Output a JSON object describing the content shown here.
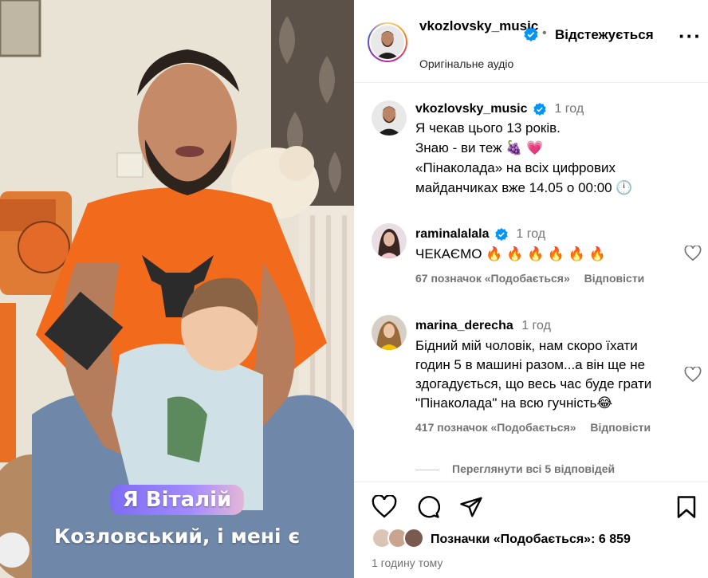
{
  "media": {
    "caption_line1": "Я Віталій",
    "caption_line2": "Козловський, і мені є",
    "shirt_color": "#f26a1b",
    "caption_gradient": [
      "#7d6cf2",
      "#e4b7d6"
    ]
  },
  "header": {
    "username": "vkozlovsky_music",
    "separator": "•",
    "follow_status": "Відстежується",
    "more_icon": "more-horizontal-icon",
    "audio": "Оригінальне аудіо"
  },
  "caption": {
    "username": "vkozlovsky_music",
    "time": "1 год",
    "lines": [
      "Я чекав цього 13 років.",
      "Знаю - ви теж 🍇 💗",
      "«Пінаколада» на всіх цифрових",
      "майданчиках вже 14.05 о 00:00 🕛"
    ]
  },
  "comments": [
    {
      "username": "raminalalala",
      "verified": true,
      "time": "1 год",
      "text": "ЧЕКАЄМО 🔥 🔥 🔥 🔥 🔥 🔥",
      "likes": "67 позначок «Подобається»",
      "reply": "Відповісти"
    },
    {
      "username": "marina_derecha",
      "verified": false,
      "time": "1 год",
      "text_lines": [
        "Бідний мій чоловік, нам скоро їхати",
        "годин 5 в машині разом...а він ще не",
        "здогадується, що весь час буде грати",
        "\"Пінаколада\" на всю гучність😂"
      ],
      "likes": "417 позначок «Подобається»",
      "reply": "Відповісти"
    }
  ],
  "view_replies": "Переглянути всі 5 відповідей",
  "actions": {
    "icons": [
      "heart-icon",
      "comment-icon",
      "share-icon",
      "bookmark-icon"
    ]
  },
  "likes_summary": "Позначки «Подобається»: 6 859",
  "posted_ago": "1 годину тому",
  "colors": {
    "verified": "#0095f6",
    "muted": "#737373"
  }
}
